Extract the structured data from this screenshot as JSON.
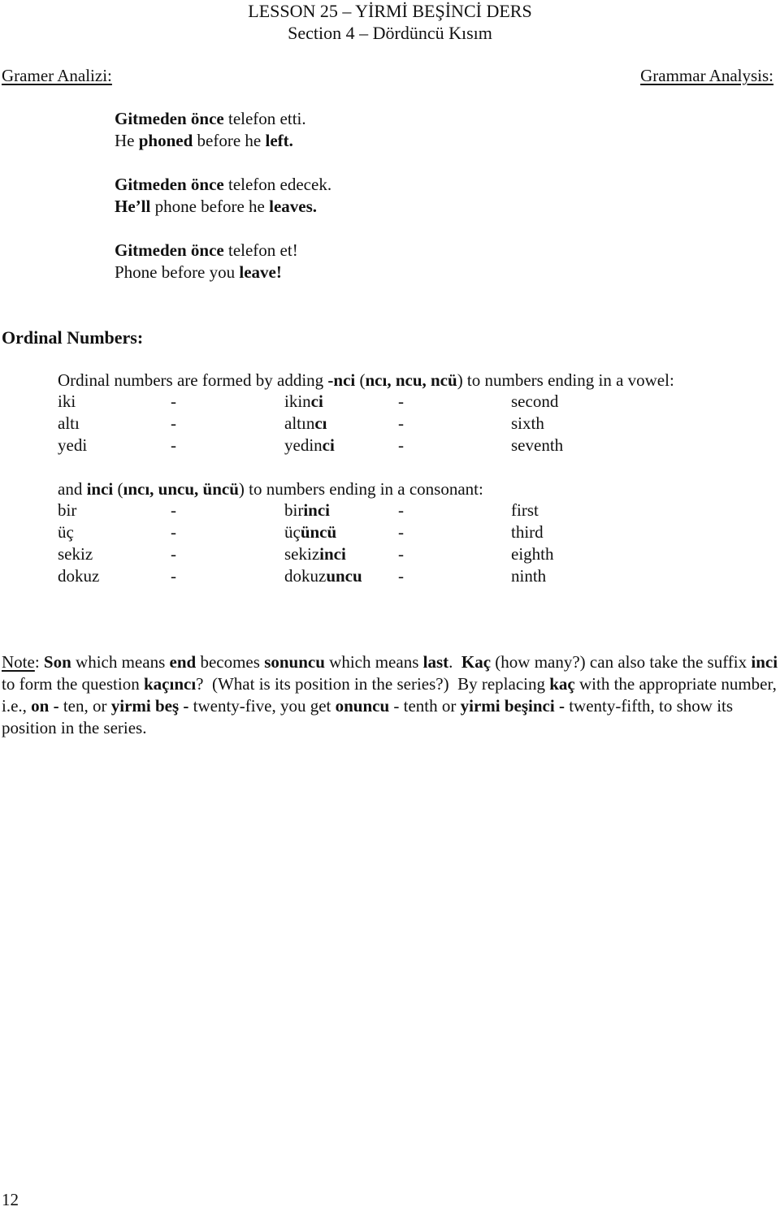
{
  "header": {
    "title": "LESSON 25 – YİRMİ BEŞİNCİ DERS",
    "subtitle": "Section 4 – Dördüncü Kısım",
    "left_label": "Gramer Analizi:",
    "right_label": "Grammar Analysis:"
  },
  "examples": [
    {
      "turkish": [
        {
          "t": "Gitmeden önce",
          "b": true
        },
        {
          "t": " telefon etti.",
          "b": false
        }
      ],
      "english": [
        {
          "t": "He ",
          "b": false
        },
        {
          "t": "phoned",
          "b": true
        },
        {
          "t": " before he ",
          "b": false
        },
        {
          "t": "left.",
          "b": true
        }
      ]
    },
    {
      "turkish": [
        {
          "t": "Gitmeden önce",
          "b": true
        },
        {
          "t": " telefon edecek.",
          "b": false
        }
      ],
      "english": [
        {
          "t": "He’ll",
          "b": true
        },
        {
          "t": " phone before he ",
          "b": false
        },
        {
          "t": "leaves.",
          "b": true
        }
      ]
    },
    {
      "turkish": [
        {
          "t": "Gitmeden önce",
          "b": true
        },
        {
          "t": " telefon et!",
          "b": false
        }
      ],
      "english": [
        {
          "t": "Phone before you ",
          "b": false
        },
        {
          "t": "leave!",
          "b": true
        }
      ]
    }
  ],
  "ordinal": {
    "heading": "Ordinal Numbers:",
    "intro_vowel": [
      {
        "t": "Ordinal numbers are formed by adding ",
        "b": false
      },
      {
        "t": "-nci",
        "b": true
      },
      {
        "t": " (",
        "b": false
      },
      {
        "t": "ncı, ncu, ncü",
        "b": true
      },
      {
        "t": ") to numbers ending in a vowel:",
        "b": false
      }
    ],
    "vowel_rows": [
      {
        "cardinal": "iki",
        "sep": "-",
        "stem": "ikin",
        "suffix": "ci",
        "sep2": "-",
        "english": "second"
      },
      {
        "cardinal": "altı",
        "sep": "-",
        "stem": "altın",
        "suffix": "cı",
        "sep2": "-",
        "english": "sixth"
      },
      {
        "cardinal": "yedi",
        "sep": "-",
        "stem": "yedin",
        "suffix": "ci",
        "sep2": "-",
        "english": "seventh"
      }
    ],
    "intro_consonant": [
      {
        "t": "and ",
        "b": false
      },
      {
        "t": "inci",
        "b": true
      },
      {
        "t": " (",
        "b": false
      },
      {
        "t": "ıncı, uncu, üncü",
        "b": true
      },
      {
        "t": ") to numbers ending in a consonant:",
        "b": false
      }
    ],
    "consonant_rows": [
      {
        "cardinal": "bir",
        "sep": "-",
        "stem": "bir",
        "suffix": "inci",
        "sep2": "-",
        "english": "first"
      },
      {
        "cardinal": "üç",
        "sep": "-",
        "stem": "üç",
        "suffix": "üncü",
        "sep2": "-",
        "english": "third"
      },
      {
        "cardinal": "sekiz",
        "sep": "-",
        "stem": "sekiz",
        "suffix": "inci",
        "sep2": "-",
        "english": "eighth"
      },
      {
        "cardinal": "dokuz",
        "sep": "-",
        "stem": "dokuz",
        "suffix": "uncu",
        "sep2": "-",
        "english": "ninth"
      }
    ]
  },
  "note": {
    "label": "Note",
    "segments": [
      {
        "t": ": ",
        "b": false
      },
      {
        "t": "Son",
        "b": true
      },
      {
        "t": " which means ",
        "b": false
      },
      {
        "t": "end",
        "b": true
      },
      {
        "t": " becomes ",
        "b": false
      },
      {
        "t": "sonuncu",
        "b": true
      },
      {
        "t": " which means ",
        "b": false
      },
      {
        "t": "last",
        "b": true
      },
      {
        "t": ".  ",
        "b": false
      },
      {
        "t": "Kaç",
        "b": true
      },
      {
        "t": " (how many?) can also take the suffix ",
        "b": false
      },
      {
        "t": "inci",
        "b": true
      },
      {
        "t": " to form the question ",
        "b": false
      },
      {
        "t": "kaçıncı",
        "b": true
      },
      {
        "t": "?  (What is its position in the series?)  By replacing ",
        "b": false
      },
      {
        "t": "kaç",
        "b": true
      },
      {
        "t": " with the appropriate number, i.e., ",
        "b": false
      },
      {
        "t": "on -",
        "b": true
      },
      {
        "t": " ten, or ",
        "b": false
      },
      {
        "t": "yirmi beş -",
        "b": true
      },
      {
        "t": " twenty-five, you get ",
        "b": false
      },
      {
        "t": "onuncu",
        "b": true
      },
      {
        "t": " - tenth or ",
        "b": false
      },
      {
        "t": "yirmi beşinci -",
        "b": true
      },
      {
        "t": " twenty-fifth, to show its position in the series.",
        "b": false
      }
    ]
  },
  "footer": {
    "page_number": "12"
  }
}
